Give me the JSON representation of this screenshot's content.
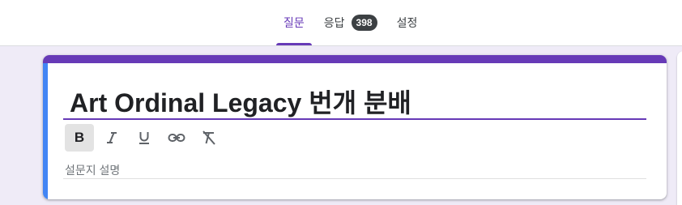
{
  "tabs": [
    {
      "label": "질문",
      "active": true
    },
    {
      "label": "응답",
      "badge": "398"
    },
    {
      "label": "설정"
    }
  ],
  "form": {
    "title": "Art Ordinal Legacy 번개 분배",
    "description_placeholder": "설문지 설명"
  },
  "toolbar": {
    "bold_label": "B",
    "items": [
      "bold",
      "italic",
      "underline",
      "link-icon",
      "clear-format-icon"
    ]
  },
  "colors": {
    "accent": "#673ab7",
    "focus_bar": "#4285f4",
    "background": "#efebf7"
  }
}
